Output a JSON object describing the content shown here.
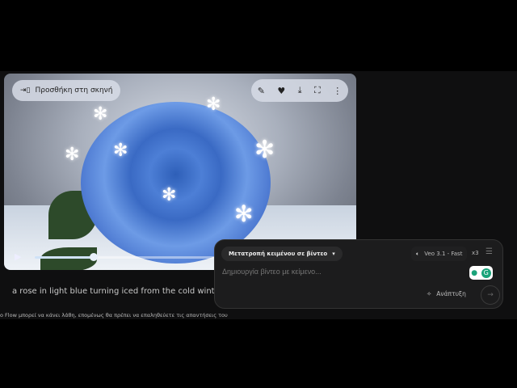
{
  "video": {
    "add_to_scene_label": "Προσθήκη στη σκηνή",
    "tools": [
      "pencil-icon",
      "heart-icon",
      "download-icon",
      "fullscreen-icon",
      "more-vert-icon"
    ],
    "progress_percent": 33
  },
  "caption": "a rose in light blue turning iced from the cold winter",
  "disclaimer": "o Flow μπορεί να κάνει λάθη, επομένως θα πρέπει να επαληθεύετε τις απαντήσεις του",
  "composer": {
    "mode_label": "Μετατροπή κειμένου σε βίντεο",
    "model_label": "Veo 3.1 - Fast",
    "count_label": "x3",
    "placeholder": "Δημιουργία βίντεο με κείμενο...",
    "expand_label": "Ανάπτυξη"
  },
  "colors": {
    "background": "#0f0f10",
    "panel": "#1c1c1d",
    "extension_green": "#1aa37a"
  }
}
